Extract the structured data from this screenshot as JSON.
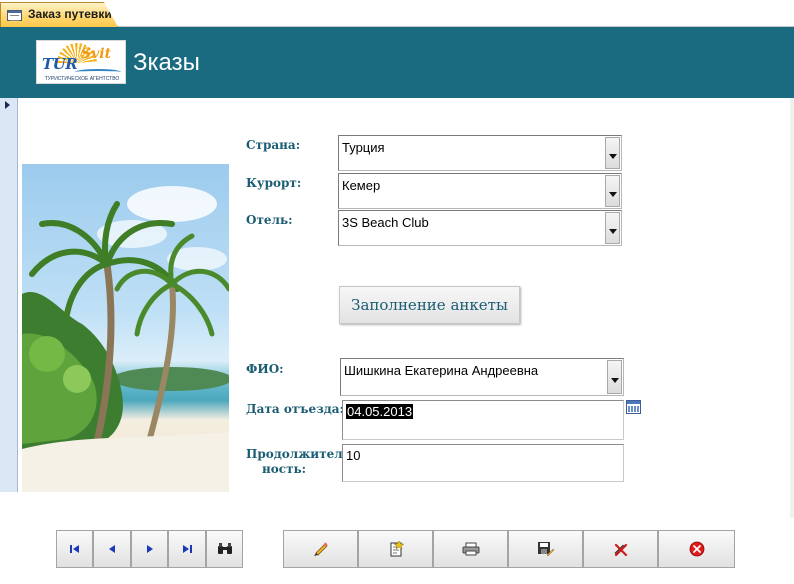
{
  "tab": {
    "label": "Заказ путевки",
    "icon": "form-icon"
  },
  "header": {
    "title": "Зказы",
    "logo": {
      "tur": "TUR",
      "svit": "Svit",
      "subtitle": "ТУРИСТИЧЕСКОЕ АГЕНТСТВО"
    },
    "colors": {
      "header_bg": "#1a6b80",
      "label": "#1a5c73"
    }
  },
  "form": {
    "country": {
      "label": "Страна:",
      "value": "Турция"
    },
    "resort": {
      "label": "Курорт:",
      "value": "Кемер"
    },
    "hotel": {
      "label": "Отель:",
      "value": "3S Beach Club"
    },
    "fill_button": {
      "label": "Заполнение анкеты"
    },
    "fio": {
      "label": "ФИО:",
      "value": "Шишкина Екатерина Андреевна"
    },
    "departure": {
      "label": "Дата отъезда:",
      "value": "04.05.2013"
    },
    "duration": {
      "label_line1": "Продолжитель",
      "label_line2": "ность:",
      "value": "10"
    }
  },
  "navigation": {
    "record_nav": [
      "first-record-icon",
      "previous-record-icon",
      "next-record-icon",
      "last-record-icon",
      "find-binoculars-icon"
    ],
    "actions": [
      "edit-pencil-icon",
      "new-record-icon",
      "print-icon",
      "save-icon",
      "delete-record-icon",
      "close-form-icon"
    ]
  }
}
